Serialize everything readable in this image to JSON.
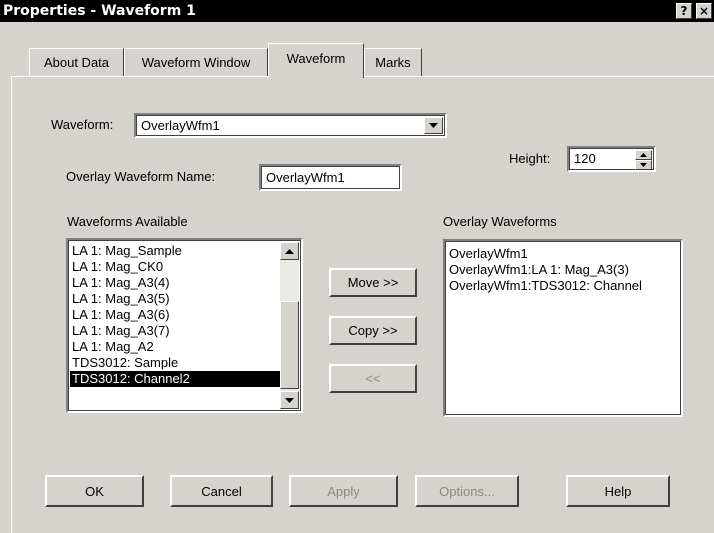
{
  "window": {
    "title": "Properties - Waveform 1",
    "help_label": "?",
    "close_label": "×"
  },
  "tabs": [
    {
      "label": "About Data"
    },
    {
      "label": "Waveform Window"
    },
    {
      "label": "Waveform"
    },
    {
      "label": "Marks"
    }
  ],
  "form": {
    "waveform_label": "Waveform:",
    "waveform_value": "OverlayWfm1",
    "overlay_name_label": "Overlay Waveform Name:",
    "overlay_name_value": "OverlayWfm1",
    "height_label": "Height:",
    "height_value": "120",
    "available_label": "Waveforms Available",
    "overlay_label": "Overlay Waveforms"
  },
  "available_list": [
    "LA 1: Mag_Sample",
    "LA 1: Mag_CK0",
    "LA 1: Mag_A3(4)",
    "LA 1: Mag_A3(5)",
    "LA 1: Mag_A3(6)",
    "LA 1: Mag_A3(7)",
    "LA 1: Mag_A2",
    "TDS3012: Sample",
    "TDS3012: Channel2"
  ],
  "available_selected": "TDS3012: Channel2",
  "overlay_list": [
    "OverlayWfm1",
    "OverlayWfm1:LA 1: Mag_A3(3)",
    "OverlayWfm1:TDS3012: Channel"
  ],
  "actions": {
    "move": "Move >>",
    "copy": "Copy >>",
    "back": "<<"
  },
  "buttons": {
    "ok": "OK",
    "cancel": "Cancel",
    "apply": "Apply",
    "options": "Options...",
    "help": "Help"
  },
  "icons": {
    "combo_arrow": "chevron-down-icon",
    "spin_up": "spin-up-icon",
    "spin_down": "spin-down-icon",
    "scroll_up": "scroll-up-icon",
    "scroll_down": "scroll-down-icon"
  }
}
